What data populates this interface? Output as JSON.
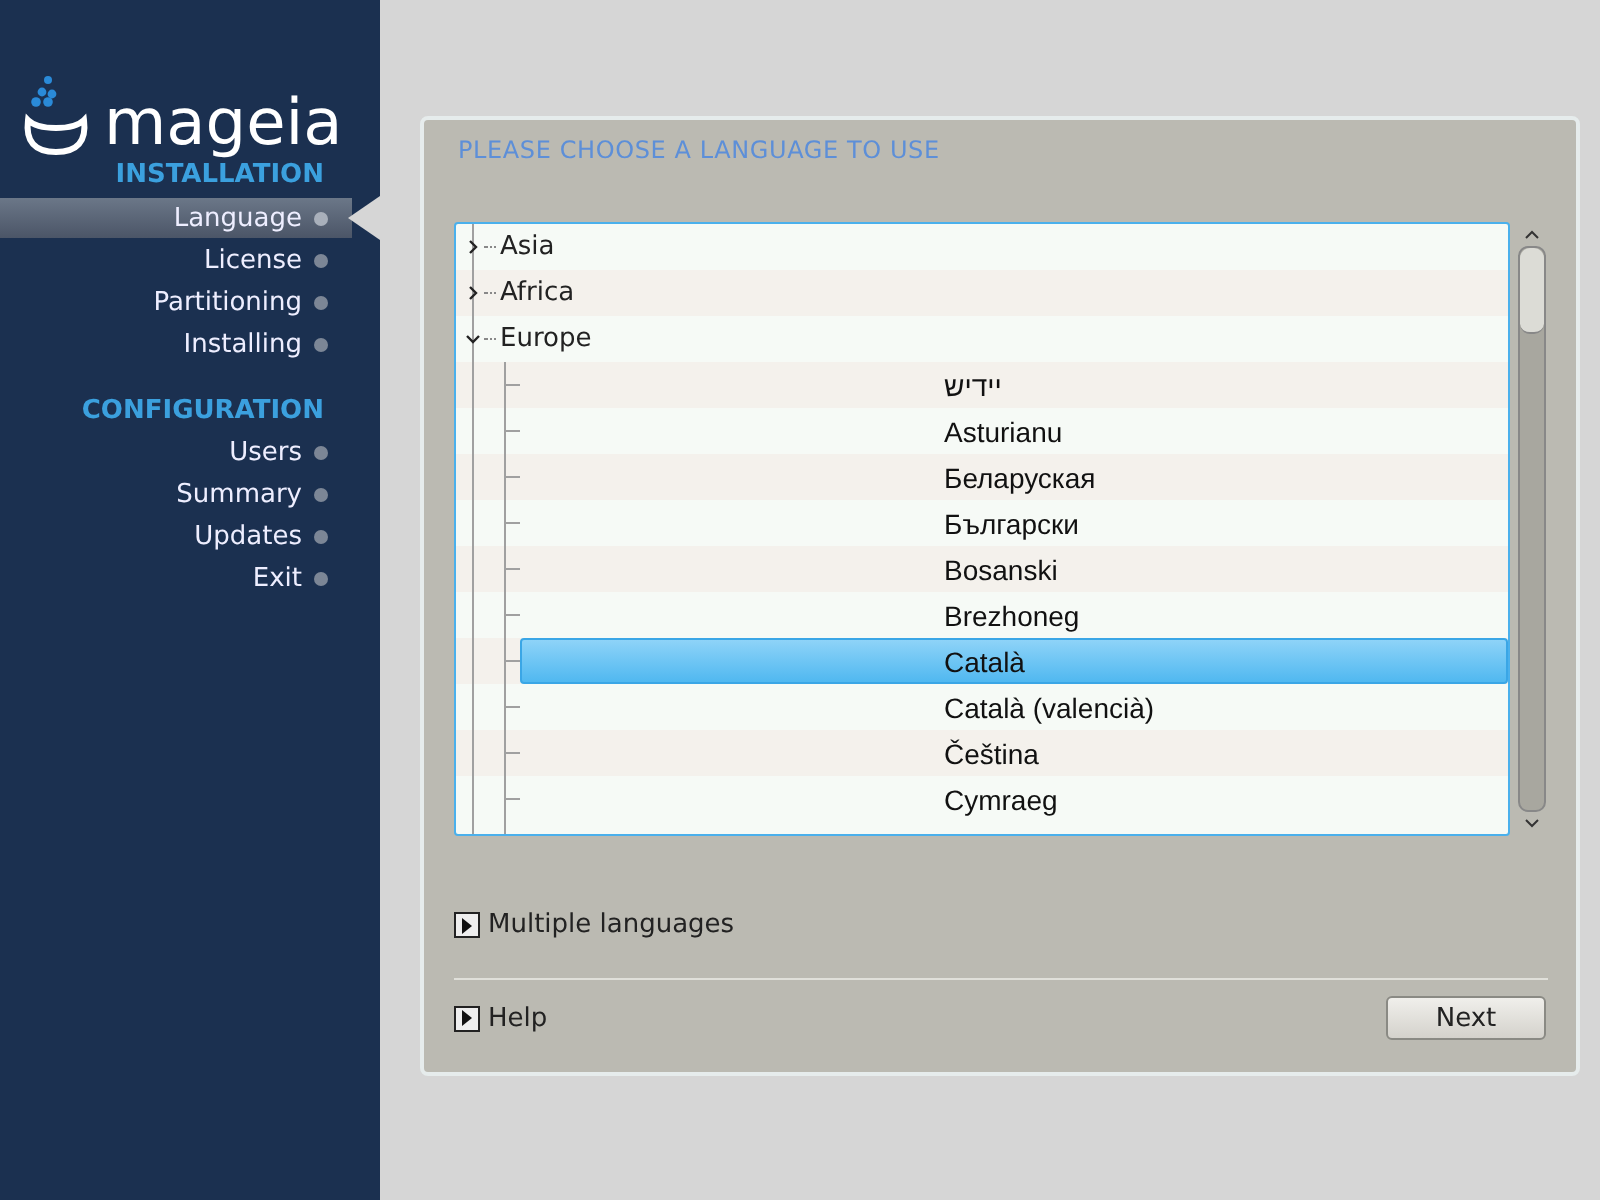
{
  "logo": {
    "text": "mageia"
  },
  "sidebar": {
    "sections": [
      {
        "title": "INSTALLATION",
        "items": [
          {
            "label": "Language",
            "selected": true
          },
          {
            "label": "License",
            "selected": false
          },
          {
            "label": "Partitioning",
            "selected": false
          },
          {
            "label": "Installing",
            "selected": false
          }
        ]
      },
      {
        "title": "CONFIGURATION",
        "items": [
          {
            "label": "Users",
            "selected": false
          },
          {
            "label": "Summary",
            "selected": false
          },
          {
            "label": "Updates",
            "selected": false
          },
          {
            "label": "Exit",
            "selected": false
          }
        ]
      }
    ]
  },
  "page": {
    "title": "PLEASE CHOOSE A LANGUAGE TO USE",
    "tree": [
      {
        "label": "Asia",
        "expanded": false
      },
      {
        "label": "Africa",
        "expanded": false
      },
      {
        "label": "Europe",
        "expanded": true,
        "children": [
          {
            "label": "יידיש",
            "selected": false
          },
          {
            "label": "Asturianu",
            "selected": false
          },
          {
            "label": "Беларуская",
            "selected": false
          },
          {
            "label": "Български",
            "selected": false
          },
          {
            "label": "Bosanski",
            "selected": false
          },
          {
            "label": "Brezhoneg",
            "selected": false
          },
          {
            "label": "Català",
            "selected": true
          },
          {
            "label": "Català (valencià)",
            "selected": false
          },
          {
            "label": "Čeština",
            "selected": false
          },
          {
            "label": "Cymraeg",
            "selected": false
          }
        ]
      }
    ],
    "expanders": [
      {
        "label": "Multiple languages",
        "expanded": false
      }
    ],
    "help": {
      "label": "Help",
      "expanded": false
    },
    "buttons": [
      "Next"
    ]
  }
}
